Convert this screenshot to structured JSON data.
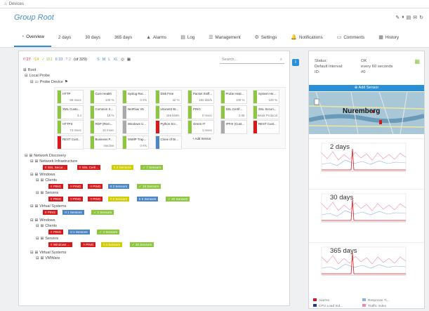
{
  "breadcrumb": {
    "home_icon": "house-icon",
    "label": "Devices"
  },
  "page": {
    "title": "Group Root"
  },
  "tabs": [
    {
      "label": "Overview",
      "icon": "overview-icon",
      "active": true
    },
    {
      "label": "2 days"
    },
    {
      "label": "30 days"
    },
    {
      "label": "365 days"
    },
    {
      "label": "Alarms",
      "icon": "warning-icon"
    },
    {
      "label": "Log",
      "icon": "log-icon"
    },
    {
      "label": "Management",
      "icon": "management-icon"
    },
    {
      "label": "Settings",
      "icon": "gear-icon"
    },
    {
      "label": "Notifications",
      "icon": "bell-icon"
    },
    {
      "label": "Comments",
      "icon": "comment-icon"
    },
    {
      "label": "History",
      "icon": "history-icon"
    }
  ],
  "filters": {
    "down": "!! 27",
    "warning": "!14",
    "up": "✓ 151",
    "paused": "II 33",
    "unknown": "? 2",
    "total": "(of 329)",
    "sizes": [
      "S",
      "M",
      "L",
      "XL"
    ],
    "search_placeholder": "Search..."
  },
  "tree": {
    "root": "Root",
    "local_probe": "Local Probe",
    "probe_device": "Probe Device",
    "network_discovery": "Network Discovery",
    "network_infrastructure": "Network Infrastructure",
    "windows": "Windows",
    "clients": "Clients",
    "servers": "Servers",
    "virtual_systems": "Virtual Systems",
    "windows2": "Windows",
    "clients2": "Clients",
    "servers2": "Servers",
    "virtual_systems2": "Virtual Systems",
    "vmware": "VMWare"
  },
  "tiles": [
    {
      "name": "HTTP",
      "value": "69 msec",
      "color": "#8dc63f"
    },
    {
      "name": "Core Health",
      "value": "100 %",
      "color": "#8dc63f"
    },
    {
      "name": "Syslog Rec...",
      "value": "0 #/s",
      "color": "#8dc63f"
    },
    {
      "name": "Disk Free",
      "value": "42 %",
      "color": "#8dc63f"
    },
    {
      "name": "Packet Sniff...",
      "value": "182 kbit/s",
      "color": "#8dc63f"
    },
    {
      "name": "Probe Heal...",
      "value": "100 %",
      "color": "#8dc63f"
    },
    {
      "name": "System He...",
      "value": "100 %",
      "color": "#8dc63f"
    },
    {
      "name": "XML Custo...",
      "value": "3.4",
      "color": "#8dc63f"
    },
    {
      "name": "Common S...",
      "value": "18 %",
      "color": "#8dc63f"
    },
    {
      "name": "NetFlow V5",
      "value": "",
      "color": "#aaaaaa"
    },
    {
      "name": "vmxnet3 Et...",
      "value": "159 kbit/s",
      "color": "#8dc63f"
    },
    {
      "name": "PING",
      "value": "0 msec",
      "color": "#8dc63f"
    },
    {
      "name": "SSL Certif...",
      "value": "2.05",
      "color": "#8dc63f"
    },
    {
      "name": "SSL Securi...",
      "value": "Weak Protocol",
      "color": "#8dc63f"
    },
    {
      "name": "HTTPS",
      "value": "74 msec",
      "color": "#8dc63f"
    },
    {
      "name": "RDP (Rem...",
      "value": "15 msec",
      "color": "#8dc63f"
    },
    {
      "name": "Windows U...",
      "value": "",
      "color": "#aaaaaa"
    },
    {
      "name": "Python Scr...",
      "value": "",
      "color": "#d7191c"
    },
    {
      "name": "Green IT",
      "value": "1 msec",
      "color": "#8dc63f"
    },
    {
      "name": "IPFIX (Cust...",
      "value": "",
      "color": "#aaaaaa"
    },
    {
      "name": "REST Cust...",
      "value": "",
      "color": "#d7191c"
    },
    {
      "name": "REST Cust...",
      "value": "",
      "color": "#d7191c"
    },
    {
      "name": "Business P...",
      "value": "Inactive",
      "color": "#8dc63f"
    },
    {
      "name": "SNMP Trap...",
      "value": "0 #/s",
      "color": "#8dc63f"
    },
    {
      "name": "Clone of Di...",
      "value": "",
      "color": "#4c86c6"
    },
    {
      "name": "+ Add Sensor",
      "value": "",
      "color": "#ffffff"
    }
  ],
  "chips": {
    "infra": [
      {
        "t": "!! SSL Secur...",
        "c": "red"
      },
      {
        "t": "!! SSL Certi...",
        "c": "red"
      },
      {
        "t": "!! 2 Sensors",
        "c": "yellow"
      },
      {
        "t": "✓ 7 Sensors",
        "c": "green"
      }
    ],
    "clients": [
      {
        "t": "!! PING",
        "c": "red"
      },
      {
        "t": "!! PING",
        "c": "red"
      },
      {
        "t": "!! PING",
        "c": "red"
      },
      {
        "t": "II 3 Sensors",
        "c": "blue"
      },
      {
        "t": "✓ 15 Sensors",
        "c": "green"
      }
    ],
    "servers": [
      {
        "t": "!! PING",
        "c": "red"
      },
      {
        "t": "!! PING",
        "c": "red"
      },
      {
        "t": "!! PING",
        "c": "red"
      },
      {
        "t": "!! 2 Sensors",
        "c": "yellow"
      },
      {
        "t": "II 5 Sensors",
        "c": "blue"
      },
      {
        "t": "✓ 20 Sensors",
        "c": "green"
      }
    ],
    "virtual": [
      {
        "t": "!! PING",
        "c": "red"
      },
      {
        "t": "II 1 Sensors",
        "c": "blue"
      },
      {
        "t": "✓ 2 Sensors",
        "c": "green"
      }
    ],
    "clients2": [
      {
        "t": "!! PING",
        "c": "red"
      },
      {
        "t": "II 1 Sensors",
        "c": "blue"
      },
      {
        "t": "✓ 4 Sensors",
        "c": "green"
      }
    ],
    "servers2": [
      {
        "t": "!! Windows ...",
        "c": "red"
      },
      {
        "t": "!! PING",
        "c": "red"
      },
      {
        "t": "!! 4 Sensors",
        "c": "yellow"
      },
      {
        "t": "✓ 30 Sensors",
        "c": "green"
      }
    ]
  },
  "details": {
    "status_label": "Status:",
    "status_value": "OK",
    "interval_label": "Default Interval:",
    "interval_value": "every 60 seconds",
    "id_label": "ID:",
    "id_value": "#0",
    "add_sensor": "Add Sensor",
    "map_label": "Nuremberg"
  },
  "graphs": [
    {
      "label": "2 days"
    },
    {
      "label": "30 days"
    },
    {
      "label": "365 days"
    }
  ],
  "legend": [
    {
      "label": "Alarms",
      "color": "#d7191c"
    },
    {
      "label": "Response Ti...",
      "color": "#8ab4e0"
    },
    {
      "label": "CPU Load Ind...",
      "color": "#1f3d8a"
    },
    {
      "label": "Traffic Index",
      "color": "#f08ab4"
    }
  ]
}
